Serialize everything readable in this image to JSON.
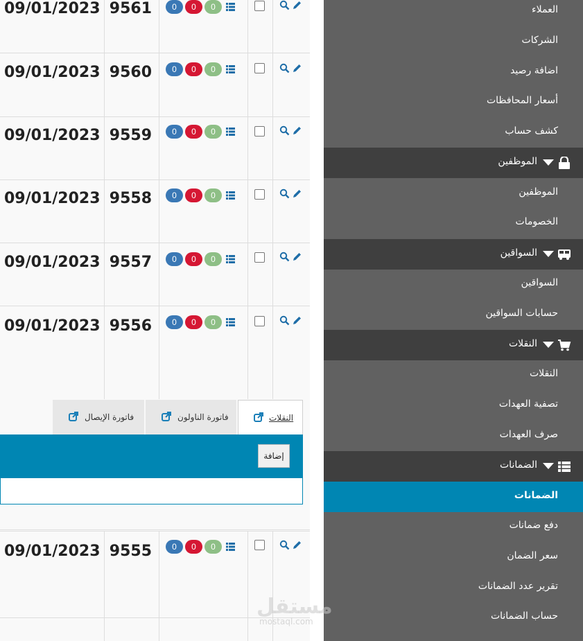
{
  "rows": [
    {
      "date": "09/01/2023",
      "number": "9561",
      "badges": [
        "0",
        "0",
        "0"
      ]
    },
    {
      "date": "09/01/2023",
      "number": "9560",
      "badges": [
        "0",
        "0",
        "0"
      ]
    },
    {
      "date": "09/01/2023",
      "number": "9559",
      "badges": [
        "0",
        "0",
        "0"
      ]
    },
    {
      "date": "09/01/2023",
      "number": "9558",
      "badges": [
        "0",
        "0",
        "0"
      ]
    },
    {
      "date": "09/01/2023",
      "number": "9557",
      "badges": [
        "0",
        "0",
        "0"
      ]
    },
    {
      "date": "09/01/2023",
      "number": "9556",
      "badges": [
        "0",
        "0",
        "0"
      ]
    },
    {
      "date": "09/01/2023",
      "number": "9555",
      "badges": [
        "0",
        "0",
        "0"
      ]
    }
  ],
  "colors": {
    "badge_blue": "#3a78b5",
    "badge_red": "#d51733",
    "badge_green": "#8ebf86",
    "accent": "#0086b3",
    "sidebar_bg": "#616161",
    "sidebar_group_bg": "#3f3f3f"
  },
  "icons": {
    "row_list": "list-icon",
    "row_search": "search-icon",
    "row_edit": "pencil-icon",
    "tab_external": "external-link-icon"
  },
  "expanded": {
    "tabs": [
      {
        "label": "النقلات",
        "active": true
      },
      {
        "label": "فاتورة الناولون",
        "active": false
      },
      {
        "label": "فاتورة الإيصال",
        "active": false
      }
    ],
    "add_button": "إضافة"
  },
  "sidebar": {
    "items": [
      {
        "label": "العملاء",
        "type": "item"
      },
      {
        "label": "الشركات",
        "type": "item"
      },
      {
        "label": "اضافة رصيد",
        "type": "item"
      },
      {
        "label": "أسعار المحافظات",
        "type": "item"
      },
      {
        "label": "كشف حساب",
        "type": "item"
      },
      {
        "label": "الموظفين",
        "type": "group",
        "icon": "lock-icon"
      },
      {
        "label": "الموظفين",
        "type": "item"
      },
      {
        "label": "الخصومات",
        "type": "item"
      },
      {
        "label": "السواقين",
        "type": "group",
        "icon": "bus-icon"
      },
      {
        "label": "السواقين",
        "type": "item"
      },
      {
        "label": "حسابات السواقين",
        "type": "item"
      },
      {
        "label": "النقلات",
        "type": "group",
        "icon": "cart-icon"
      },
      {
        "label": "النقلات",
        "type": "item"
      },
      {
        "label": "تصفية العهدات",
        "type": "item"
      },
      {
        "label": "صرف العهدات",
        "type": "item"
      },
      {
        "label": "الضمانات",
        "type": "group",
        "icon": "list-icon"
      },
      {
        "label": "الضمانات",
        "type": "active"
      },
      {
        "label": "دفع ضمانات",
        "type": "item"
      },
      {
        "label": "سعر الضمان",
        "type": "item"
      },
      {
        "label": "تقرير عدد الضمانات",
        "type": "item"
      },
      {
        "label": "حساب الضمانات",
        "type": "item"
      }
    ]
  },
  "watermark": {
    "logo": "مستقل",
    "url": "mostaql.com"
  }
}
